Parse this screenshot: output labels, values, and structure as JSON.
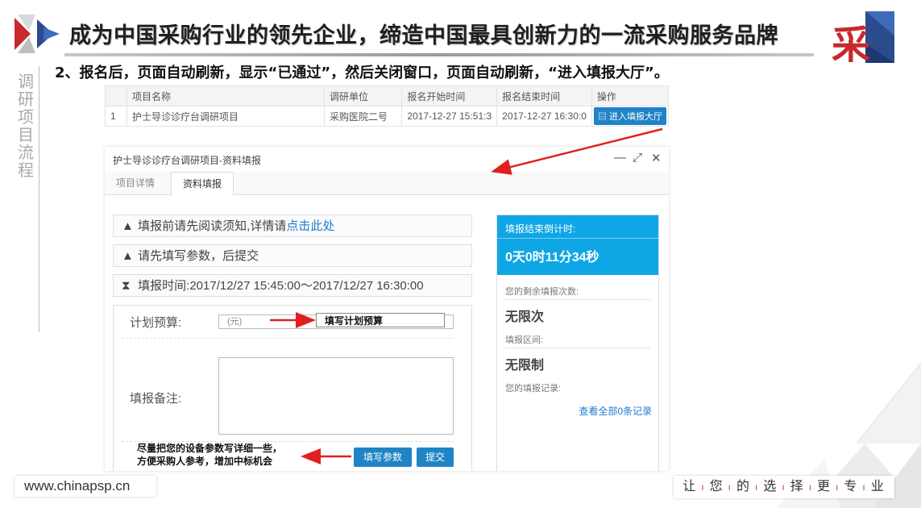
{
  "slide": {
    "title": "成为中国采购行业的领先企业，缔造中国最具创新力的一流采购服务品牌",
    "step": "2、报名后，页面自动刷新，显示“已通过”，然后关闭窗口，页面自动刷新，“进入填报大厅”。",
    "side_label": [
      "调",
      "研",
      "项",
      "目",
      "流",
      "程"
    ],
    "logo_right_char": "采"
  },
  "table": {
    "headers": [
      "",
      "项目名称",
      "调研单位",
      "报名开始时间",
      "报名结束时间",
      "操作"
    ],
    "row": {
      "index": "1",
      "name": "护士导诊诊疗台调研项目",
      "unit": "采购医院二号",
      "start": "2017-12-27 15:51:3",
      "end": "2017-12-27 16:30:0",
      "action": "进入填报大厅"
    }
  },
  "dialog": {
    "title": "护士导诊诊疗台调研项目-资料填报",
    "tabs": [
      {
        "label": "项目详情",
        "active": false
      },
      {
        "label": "资料填报",
        "active": true
      }
    ],
    "notice1": "填报前请先阅读须知,详情请",
    "notice1_link": "点击此处",
    "notice2": "请先填写参数，后提交",
    "notice3": "填报时间:2017/12/27 15:45:00～2017/12/27 16:30:00",
    "budget_label": "计划预算:",
    "budget_placeholder": "(元)",
    "remarks_label": "填报备注:",
    "fill_params_button": "填写参数",
    "submit_button": "提交"
  },
  "panel": {
    "countdown_label": "填报结束倒计时:",
    "countdown_value": "0天0时11分34秒",
    "remaining_label": "您的剩余填报次数:",
    "remaining_value": "无限次",
    "interval_label": "填报区间:",
    "interval_value": "无限制",
    "records_label": "您的填报记录:",
    "records_link": "查看全部0条记录"
  },
  "annotations": {
    "budget_note": "填写计划预算",
    "params_note_line1": "尽量把您的设备参数写详细一些，",
    "params_note_line2": "方便采购人参考，增加中标机会"
  },
  "footer": {
    "url": "www.chinapsp.cn",
    "slogan": [
      "让",
      "您",
      "的",
      "选",
      "择",
      "更",
      "专",
      "业"
    ]
  },
  "colors": {
    "accent_blue": "#1f84c6",
    "countdown_blue": "#0fa6e6",
    "arrow_red": "#e02020",
    "logo_red": "#c8282e"
  }
}
